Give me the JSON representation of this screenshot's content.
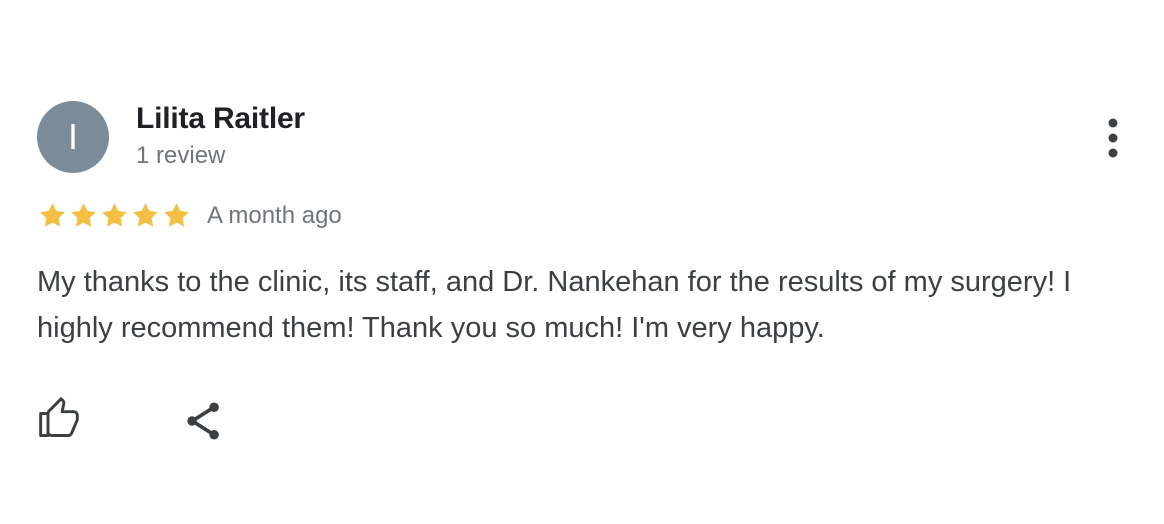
{
  "reviewer": {
    "avatar_initial": "I",
    "name": "Lilita Raitler",
    "review_count": "1 review"
  },
  "review": {
    "rating": 5,
    "max_rating": 5,
    "date": "A month ago",
    "text": "My thanks to the clinic, its staff, and Dr. Nankehan for the results of my surgery! I highly recommend them! Thank you so much! I'm very happy."
  },
  "icons": {
    "more": "more-vert-icon",
    "star": "star-icon",
    "like": "thumb-up-icon",
    "share": "share-icon"
  },
  "colors": {
    "avatar_bg": "#7a8b99",
    "star": "#f4bf42",
    "icon": "#3c4043"
  }
}
